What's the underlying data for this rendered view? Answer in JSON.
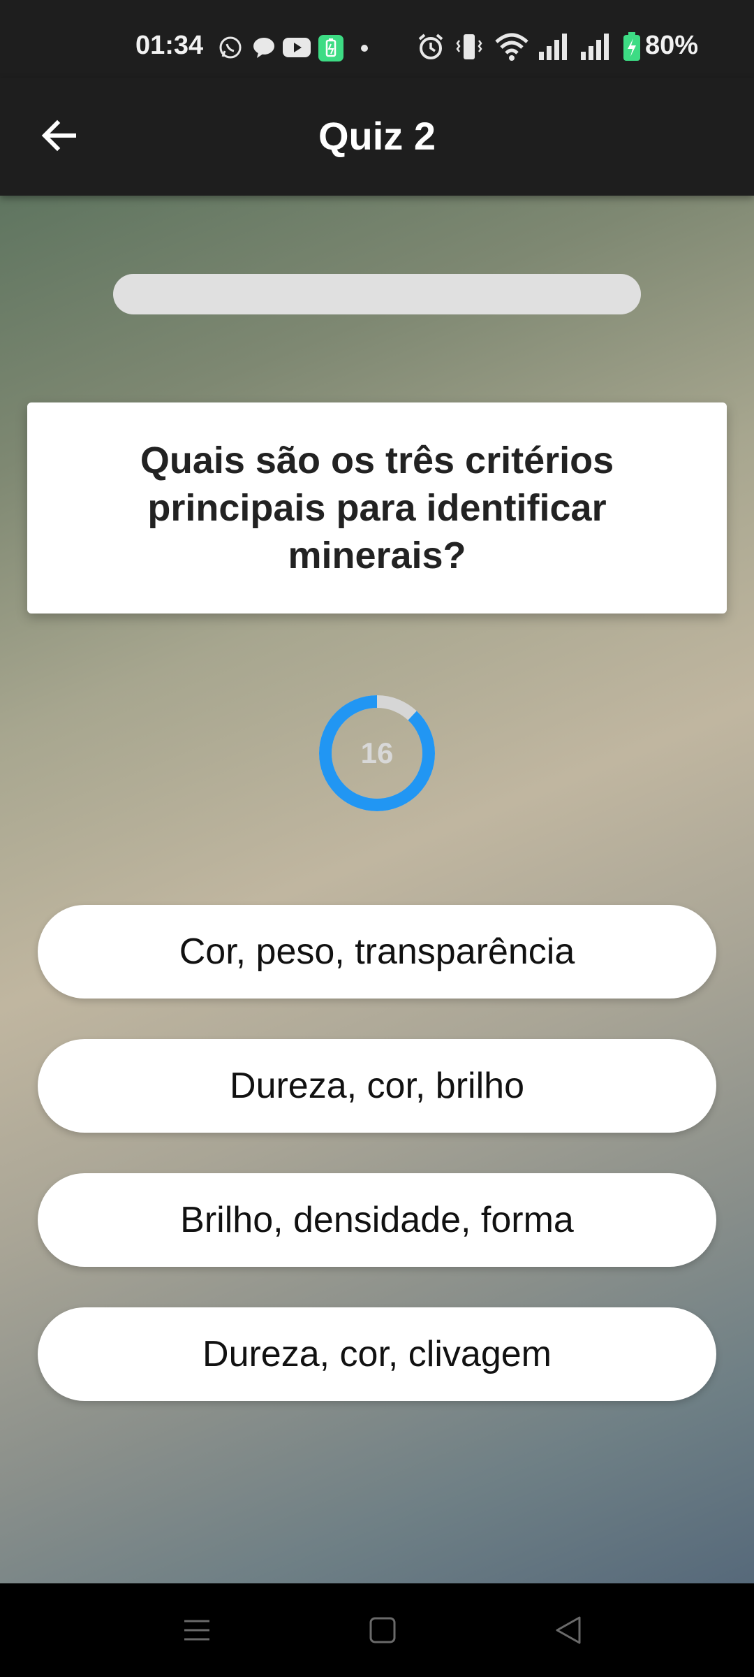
{
  "status_bar": {
    "time": "01:34",
    "battery_percent": "80%",
    "notification_icons": [
      "whatsapp-icon",
      "chat-bubble-icon",
      "youtube-icon",
      "battery-saver-icon",
      "dot-icon"
    ],
    "system_icons": [
      "alarm-icon",
      "vibrate-icon",
      "wifi-icon",
      "signal-icon",
      "signal-icon",
      "battery-charging-icon"
    ]
  },
  "app_bar": {
    "title": "Quiz 2",
    "back_icon": "arrow-left-icon"
  },
  "quiz": {
    "progress_fraction": 0.0,
    "question": "Quais são os três critérios principais para identificar minerais?",
    "timer": {
      "value": "16",
      "fraction_remaining": 0.88,
      "ring_color": "#2196f3",
      "track_color": "#d6d6d6"
    },
    "answers": [
      "Cor, peso, transparência",
      "Dureza, cor, brilho",
      "Brilho, densidade, forma",
      "Dureza, cor, clivagem"
    ]
  },
  "nav_bar": {
    "icons": [
      "menu-icon",
      "home-icon",
      "back-triangle-icon"
    ]
  },
  "colors": {
    "accent": "#2196f3",
    "app_bar": "#1e1e1e"
  }
}
